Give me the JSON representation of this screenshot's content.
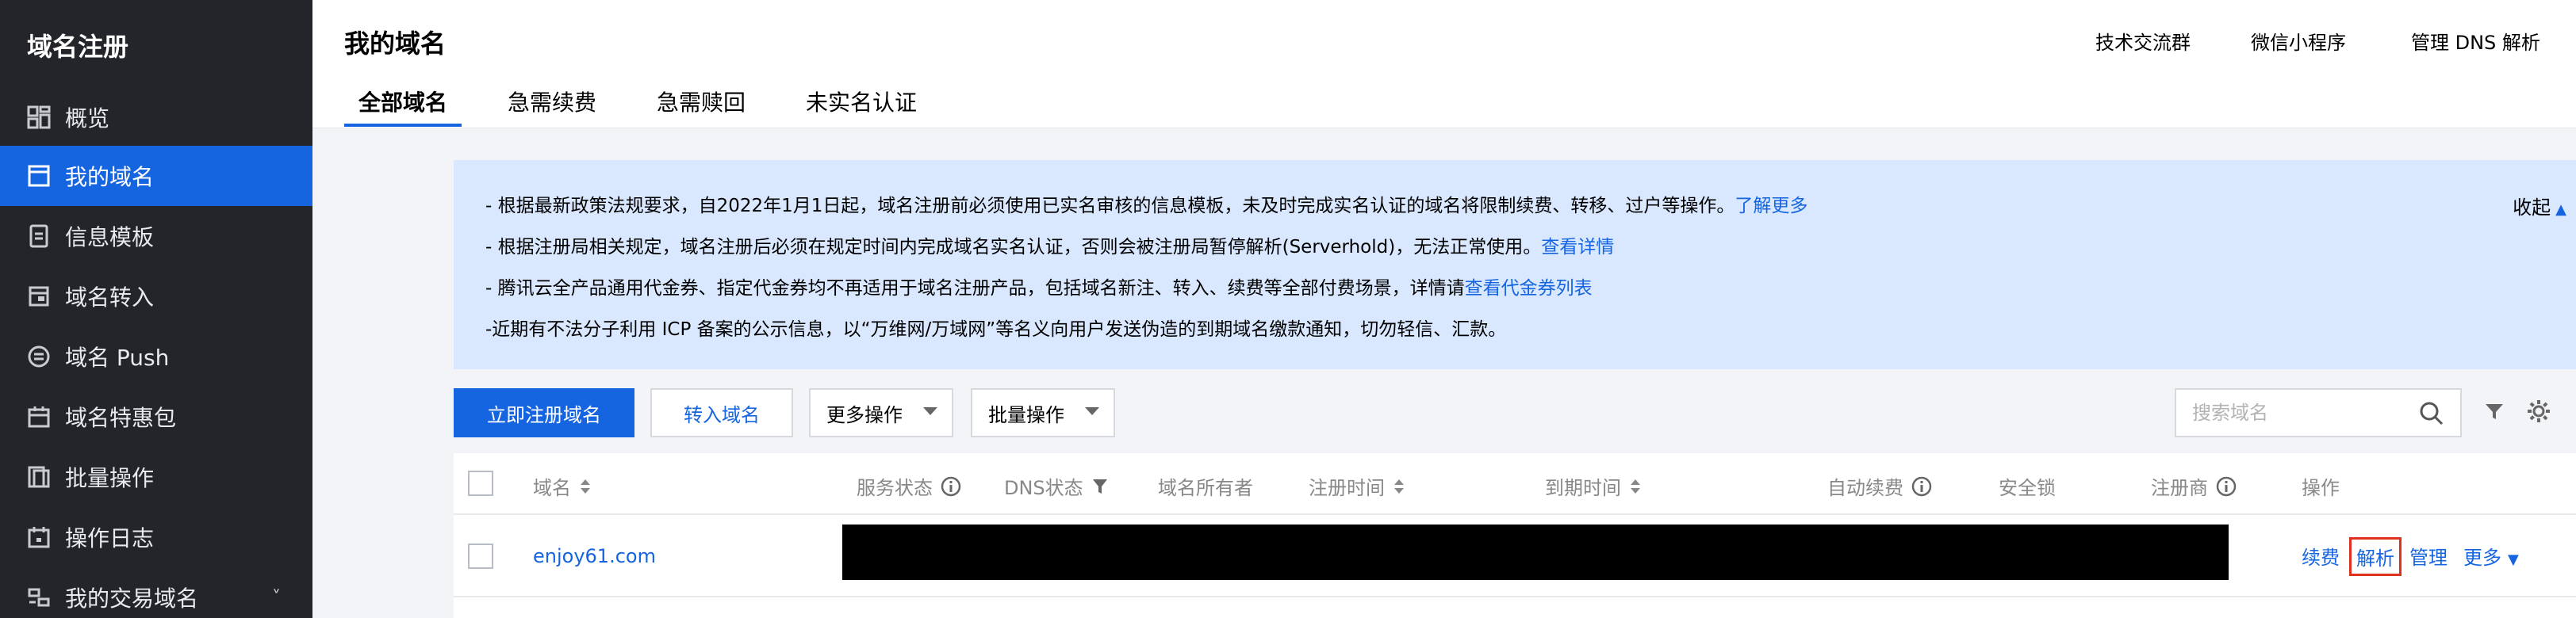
{
  "sidebar": {
    "title": "域名注册",
    "items": [
      {
        "label": "概览",
        "icon": "dashboard-icon"
      },
      {
        "label": "我的域名",
        "icon": "browser-window-icon",
        "active": true
      },
      {
        "label": "信息模板",
        "icon": "document-icon"
      },
      {
        "label": "域名转入",
        "icon": "transfer-in-icon"
      },
      {
        "label": "域名 Push",
        "icon": "push-icon"
      },
      {
        "label": "域名特惠包",
        "icon": "gift-calendar-icon"
      },
      {
        "label": "批量操作",
        "icon": "batch-copy-icon"
      },
      {
        "label": "操作日志",
        "icon": "calendar-log-icon"
      },
      {
        "label": "我的交易域名",
        "icon": "trade-icon",
        "chevron": "˅"
      }
    ]
  },
  "header": {
    "title": "我的域名",
    "links": [
      "技术交流群",
      "微信小程序",
      "管理 DNS 解析"
    ],
    "tabs": [
      "全部域名",
      "急需续费",
      "急需赎回",
      "未实名认证"
    ],
    "active_tab": 0
  },
  "notice": {
    "lines": [
      {
        "text": "- 根据最新政策法规要求，自2022年1月1日起，域名注册前必须使用已实名审核的信息模板，未及时完成实名认证的域名将限制续费、转移、过户等操作。",
        "link": "了解更多"
      },
      {
        "text": "- 根据注册局相关规定，域名注册后必须在规定时间内完成域名实名认证，否则会被注册局暂停解析(Serverhold)，无法正常使用。",
        "link": "查看详情"
      },
      {
        "text": "- 腾讯云全产品通用代金券、指定代金券均不再适用于域名注册产品，包括域名新注、转入、续费等全部付费场景，详情请",
        "link": "查看代金券列表"
      },
      {
        "text": "-近期有不法分子利用 ICP 备案的公示信息，以“万维网/万域网”等名义向用户发送伪造的到期域名缴款通知，切勿轻信、汇款。",
        "link": ""
      }
    ],
    "collapse_label": "收起"
  },
  "toolbar": {
    "register_label": "立即注册域名",
    "transfer_label": "转入域名",
    "more_label": "更多操作",
    "batch_label": "批量操作",
    "search_placeholder": "搜索域名"
  },
  "table": {
    "columns": [
      "域名",
      "服务状态",
      "DNS状态",
      "域名所有者",
      "注册时间",
      "到期时间",
      "自动续费",
      "安全锁",
      "注册商",
      "操作"
    ],
    "rows": [
      {
        "domain": "enjoy61.com",
        "actions": [
          "续费",
          "解析",
          "管理",
          "更多"
        ]
      }
    ]
  },
  "colors": {
    "accent": "#1665e0",
    "sidebar_bg": "#23252b",
    "notice_bg": "#d9e8ff",
    "highlight": "#e0301e"
  }
}
